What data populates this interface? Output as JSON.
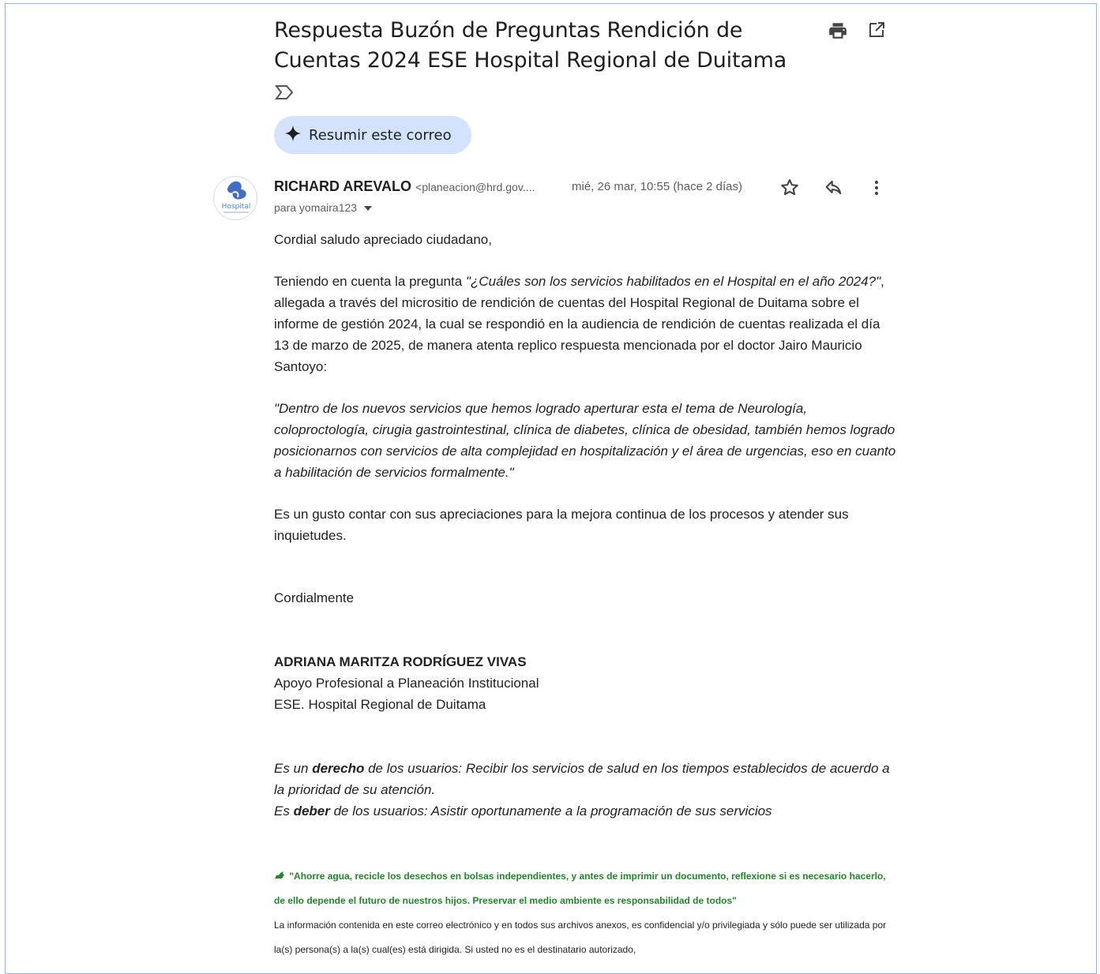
{
  "email": {
    "subject": "Respuesta Buzón de Preguntas Rendición de Cuentas 2024 ESE Hospital Regional de Duitama",
    "summarize_label": "Resumir este correo",
    "avatar_text": "Hospital",
    "sender_name": "RICHARD AREVALO",
    "sender_email": "<planeacion@hrd.gov....",
    "date": "mié, 26 mar, 10:55 (hace 2 días)",
    "to": "para yomaira123",
    "greeting": "Cordial saludo apreciado ciudadano,",
    "p1_a": "Teniendo en cuenta la pregunta ",
    "p1_question": "\"¿Cuáles son los servicios habilitados en el Hospital en el año 2024?\"",
    "p1_b": ", allegada a través del micrositio de rendición de cuentas del Hospital Regional de Duitama sobre el informe de gestión 2024, la cual se respondió en la audiencia de rendición de cuentas realizada el día 13 de marzo de 2025, de manera atenta replico respuesta mencionada por el doctor Jairo Mauricio Santoyo:",
    "quote": "\"Dentro de los nuevos servicios que hemos logrado aperturar esta el tema de Neurología, coloproctología, cirugia gastrointestinal, clínica de diabetes, clínica de obesidad, también hemos logrado posicionarnos con servicios de alta complejidad en hospitalización y el área de urgencias, eso en cuanto a habilitación de servicios formalmente.\"",
    "p3": "Es un gusto contar con sus apreciaciones para la mejora continua de los procesos y atender sus inquietudes.",
    "closing": "Cordialmente",
    "sig_name": "ADRIANA MARITZA RODRÍGUEZ VIVAS",
    "sig_role": "Apoyo Profesional a Planeación Institucional",
    "sig_org": "ESE. Hospital Regional de Duitama",
    "right_a": "Es un ",
    "right_bold": "derecho",
    "right_b": " de los usuarios: Recibir los servicios de salud en los tiempos establecidos de acuerdo a la prioridad de su atención.",
    "duty_a": "Es ",
    "duty_bold": "deber",
    "duty_b": " de los usuarios: Asistir oportunamente a la programación de sus servicios",
    "eco": "\"Ahorre agua, recicle los desechos en bolsas independientes, y antes de imprimir un documento, reflexione si es necesario hacerlo, de ello depende el futuro de nuestros hijos. Preservar el medio ambiente es responsabilidad de todos\"",
    "disclaimer": "La información contenida en este correo electrónico y en todos sus archivos anexos, es confidencial y/o privilegiada y sólo puede ser utilizada por la(s) persona(s) a la(s) cual(es) está dirigida. Si usted no es el destinatario autorizado,"
  },
  "icons": {
    "print": "print-icon",
    "open": "open-in-new-window-icon",
    "label": "label-importance-icon",
    "sparkle": "sparkle-icon",
    "star": "star-icon",
    "reply": "reply-icon",
    "more": "more-vert-icon",
    "caret": "caret-down-icon",
    "recycle": "recycle-icon"
  },
  "colors": {
    "summarize_bg": "#d3e3fd",
    "eco_green": "#1e8a25",
    "frame_border": "#8ab4f8"
  }
}
